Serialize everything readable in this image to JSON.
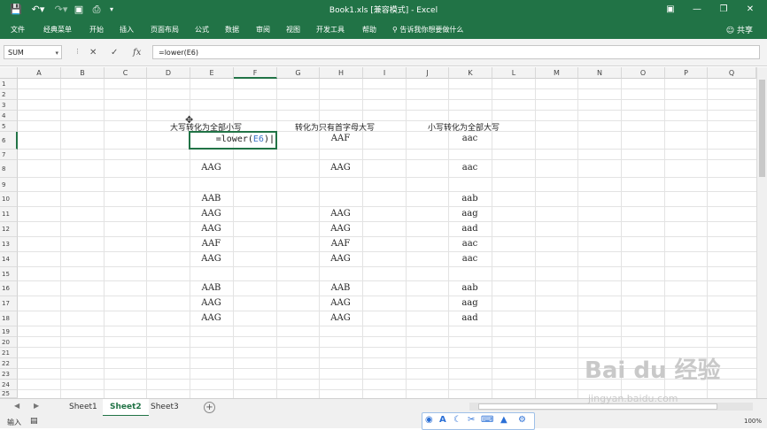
{
  "app": {
    "title": "Book1.xls  [兼容模式]  -  Excel",
    "theme_color": "#217346",
    "qat_icons": [
      "save-icon",
      "undo-icon",
      "redo-icon",
      "form-icon",
      "print-preview-icon",
      "customize-icon"
    ],
    "window_icons": [
      "ribbon-display-icon",
      "minimize-icon",
      "restore-icon",
      "close-icon"
    ]
  },
  "ribbon": {
    "tabs": [
      "文件",
      "经典菜单",
      "开始",
      "插入",
      "页面布局",
      "公式",
      "数据",
      "审阅",
      "视图",
      "开发工具",
      "帮助"
    ],
    "tell_me": "告诉我你想要做什么",
    "share": "共享"
  },
  "formula_bar": {
    "name_box": "SUM",
    "cancel": "✕",
    "enter": "✓",
    "fx": "fx",
    "formula": "=lower(E6)"
  },
  "columns": [
    "A",
    "B",
    "C",
    "D",
    "E",
    "F",
    "G",
    "H",
    "I",
    "J",
    "K",
    "L",
    "M",
    "N",
    "O",
    "P",
    "Q"
  ],
  "rows": [
    "1",
    "2",
    "3",
    "4",
    "5",
    "6",
    "7",
    "8",
    "9",
    "10",
    "11",
    "12",
    "13",
    "14",
    "15",
    "16",
    "17",
    "18",
    "19",
    "20",
    "21",
    "22",
    "23",
    "24",
    "25"
  ],
  "labels": {
    "lower_title": "大写转化为全部小写",
    "proper_title": "转化为只有首字母大写",
    "upper_title": "小写转化为全部大写"
  },
  "editing_cell": {
    "prefix": "=lower(",
    "ref": "E6",
    "suffix": ")"
  },
  "cells": [
    {
      "col": "H",
      "row": 6,
      "value": "AAF"
    },
    {
      "col": "K",
      "row": 6,
      "value": "aac"
    },
    {
      "col": "E",
      "row": 8,
      "value": "AAG"
    },
    {
      "col": "H",
      "row": 8,
      "value": "AAG"
    },
    {
      "col": "K",
      "row": 8,
      "value": "aac"
    },
    {
      "col": "E",
      "row": 10,
      "value": "AAB"
    },
    {
      "col": "K",
      "row": 10,
      "value": "aab"
    },
    {
      "col": "E",
      "row": 11,
      "value": "AAG"
    },
    {
      "col": "H",
      "row": 11,
      "value": "AAG"
    },
    {
      "col": "K",
      "row": 11,
      "value": "aag"
    },
    {
      "col": "E",
      "row": 12,
      "value": "AAG"
    },
    {
      "col": "H",
      "row": 12,
      "value": "AAG"
    },
    {
      "col": "K",
      "row": 12,
      "value": "aad"
    },
    {
      "col": "E",
      "row": 13,
      "value": "AAF"
    },
    {
      "col": "H",
      "row": 13,
      "value": "AAF"
    },
    {
      "col": "K",
      "row": 13,
      "value": "aac"
    },
    {
      "col": "E",
      "row": 14,
      "value": "AAG"
    },
    {
      "col": "H",
      "row": 14,
      "value": "AAG"
    },
    {
      "col": "K",
      "row": 14,
      "value": "aac"
    },
    {
      "col": "E",
      "row": 16,
      "value": "AAB"
    },
    {
      "col": "H",
      "row": 16,
      "value": "AAB"
    },
    {
      "col": "K",
      "row": 16,
      "value": "aab"
    },
    {
      "col": "E",
      "row": 17,
      "value": "AAG"
    },
    {
      "col": "H",
      "row": 17,
      "value": "AAG"
    },
    {
      "col": "K",
      "row": 17,
      "value": "aag"
    },
    {
      "col": "E",
      "row": 18,
      "value": "AAG"
    },
    {
      "col": "H",
      "row": 18,
      "value": "AAG"
    },
    {
      "col": "K",
      "row": 18,
      "value": "aad"
    }
  ],
  "sheets": [
    "Sheet1",
    "Sheet2",
    "Sheet3"
  ],
  "active_sheet": "Sheet2",
  "status": {
    "mode": "输入",
    "zoom": "100%"
  },
  "ime_icons": [
    "paw-icon",
    "letter-a-icon",
    "moon-icon",
    "scissors-icon",
    "keyboard-icon",
    "shirt-icon",
    "gear-icon"
  ],
  "watermark": {
    "brand": "Bai du 经验",
    "url": "jingyan.baidu.com"
  }
}
